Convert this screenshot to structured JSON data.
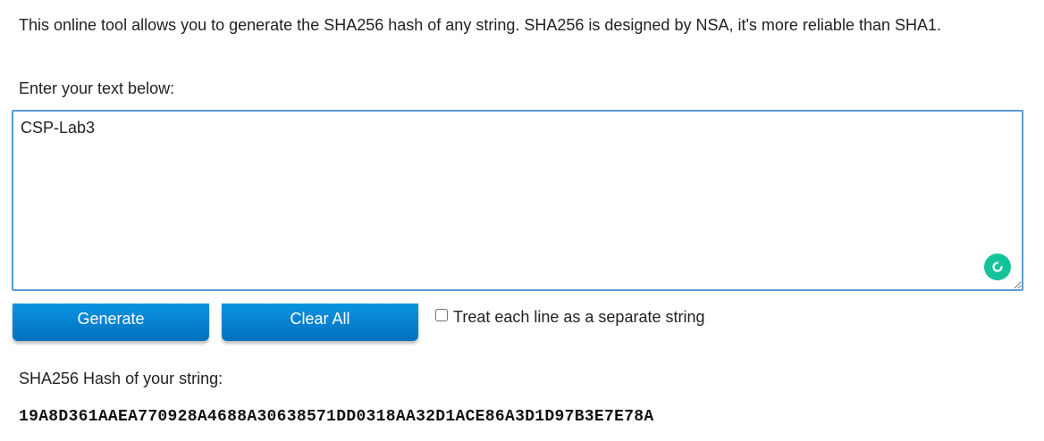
{
  "intro": {
    "text": "This online tool allows you to generate the SHA256 hash of any string. SHA256 is designed by NSA, it's more reliable than SHA1."
  },
  "input": {
    "prompt": "Enter your text below:",
    "value": "CSP-Lab3"
  },
  "buttons": {
    "generate_label": "Generate",
    "clear_label": "Clear All"
  },
  "options": {
    "separate_lines_label": "Treat each line as a separate string",
    "separate_lines_checked": false
  },
  "result": {
    "label": "SHA256 Hash of your string:",
    "hash": "19A8D361AAEA770928A4688A30638571DD0318AA32D1ACE86A3D1D97B3E7E78A"
  },
  "icons": {
    "grammarly": "grammarly-icon"
  },
  "colors": {
    "button": "#0b8be0",
    "input_border": "#5b9bd5",
    "grammarly": "#15c39a"
  }
}
